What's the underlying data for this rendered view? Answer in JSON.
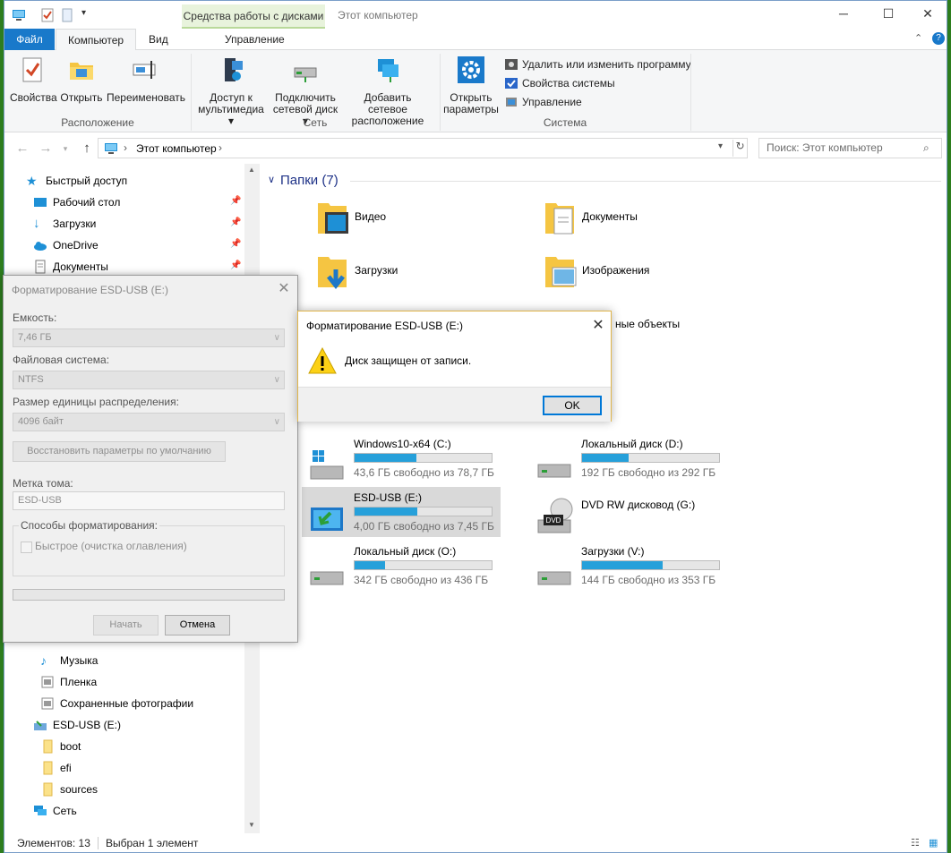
{
  "window": {
    "title": "Этот компьютер",
    "context_tab": "Средства работы с дисками",
    "minimize": "─",
    "maximize": "☐",
    "close": "✕"
  },
  "menu_tabs": {
    "file": "Файл",
    "computer": "Компьютер",
    "view": "Вид",
    "manage": "Управление"
  },
  "ribbon": {
    "location": {
      "label": "Расположение",
      "properties": "Свойства",
      "open": "Открыть",
      "rename": "Переименовать"
    },
    "network": {
      "label": "Сеть",
      "media_1": "Доступ к",
      "media_2": "мультимедиа",
      "map_1": "Подключить",
      "map_2": "сетевой диск",
      "add_1": "Добавить сетевое",
      "add_2": "расположение"
    },
    "system": {
      "label": "Система",
      "settings_1": "Открыть",
      "settings_2": "параметры",
      "uninstall": "Удалить или изменить программу",
      "sysprops": "Свойства системы",
      "manage": "Управление"
    }
  },
  "address": {
    "path": "Этот компьютер",
    "search_placeholder": "Поиск: Этот компьютер"
  },
  "nav": {
    "quick_access": "Быстрый доступ",
    "desktop": "Рабочий стол",
    "downloads": "Загрузки",
    "onedrive": "OneDrive",
    "documents": "Документы",
    "music": "Музыка",
    "film": "Пленка",
    "saved_photos": "Сохраненные фотографии",
    "esd_usb": "ESD-USB (E:)",
    "boot": "boot",
    "efi": "efi",
    "sources": "sources",
    "network": "Сеть"
  },
  "folders": {
    "header": "Папки (7)",
    "video": "Видео",
    "docs": "Документы",
    "downloads": "Загрузки",
    "images": "Изображения",
    "volumes": "ные объекты"
  },
  "drives": [
    {
      "name": "Windows10-x64 (C:)",
      "free": "43,6 ГБ свободно из 78,7 ГБ",
      "used_fraction": 0.45
    },
    {
      "name": "Локальный диск (D:)",
      "free": "192 ГБ свободно из 292 ГБ",
      "used_fraction": 0.34
    },
    {
      "name": "ESD-USB (E:)",
      "free": "4,00 ГБ свободно из 7,45 ГБ",
      "used_fraction": 0.46
    },
    {
      "name": "DVD RW дисковод (G:)"
    },
    {
      "name": "Локальный диск (O:)",
      "free": "342 ГБ свободно из 436 ГБ",
      "used_fraction": 0.22
    },
    {
      "name": "Загрузки (V:)",
      "free": "144 ГБ свободно из 353 ГБ",
      "used_fraction": 0.59
    }
  ],
  "status": {
    "items": "Элементов: 13",
    "selected": "Выбран 1 элемент"
  },
  "format_dialog": {
    "title": "Форматирование ESD-USB (E:)",
    "capacity_label": "Емкость:",
    "capacity": "7,46 ГБ",
    "fs_label": "Файловая система:",
    "fs": "NTFS",
    "alloc_label": "Размер единицы распределения:",
    "alloc": "4096 байт",
    "restore_defaults": "Восстановить параметры по умолчанию",
    "volume_label": "Метка тома:",
    "volume": "ESD-USB",
    "methods_label": "Способы форматирования:",
    "quick": "Быстрое (очистка оглавления)",
    "start": "Начать",
    "cancel": "Отмена"
  },
  "message_box": {
    "title": "Форматирование ESD-USB (E:)",
    "text": "Диск защищен от записи.",
    "ok": "OK"
  },
  "colors": {
    "accent": "#1979ca",
    "drive_fill": "#26a0da",
    "section_header": "#1e3287"
  }
}
